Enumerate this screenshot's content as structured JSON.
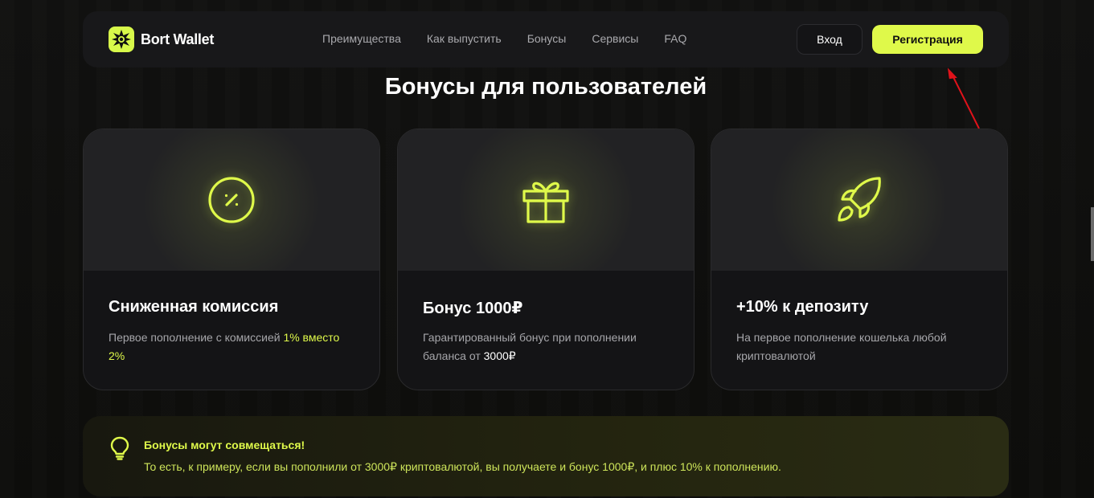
{
  "header": {
    "logo_text": "Bort Wallet",
    "nav": [
      "Преимущества",
      "Как выпустить",
      "Бонусы",
      "Сервисы",
      "FAQ"
    ],
    "login_label": "Вход",
    "register_label": "Регистрация"
  },
  "section": {
    "title": "Бонусы для пользователей"
  },
  "cards": [
    {
      "icon": "percent-icon",
      "title": "Сниженная комиссия",
      "desc_prefix": "Первое пополнение с комиссией ",
      "desc_highlight": "1% вместо 2%",
      "desc_suffix": ""
    },
    {
      "icon": "gift-icon",
      "title": "Бонус 1000₽",
      "desc_prefix": "Гарантированный бонус при пополнении баланса от ",
      "desc_highlight": "3000₽",
      "desc_suffix": ""
    },
    {
      "icon": "rocket-icon",
      "title": "+10% к депозиту",
      "desc_prefix": "На первое пополнение кошелька любой криптовалютой",
      "desc_highlight": "",
      "desc_suffix": ""
    }
  ],
  "banner": {
    "icon": "lightbulb-icon",
    "title": "Бонусы могут совмещаться!",
    "text": "То есть, к примеру, если вы пополнили от 3000₽ криптовалютой, вы получаете и бонус 1000₽, и плюс 10% к пополнению."
  },
  "colors": {
    "accent": "#dff94a",
    "background": "#0e0e0c",
    "card": "#141416",
    "annotation_arrow": "#e0121a"
  }
}
